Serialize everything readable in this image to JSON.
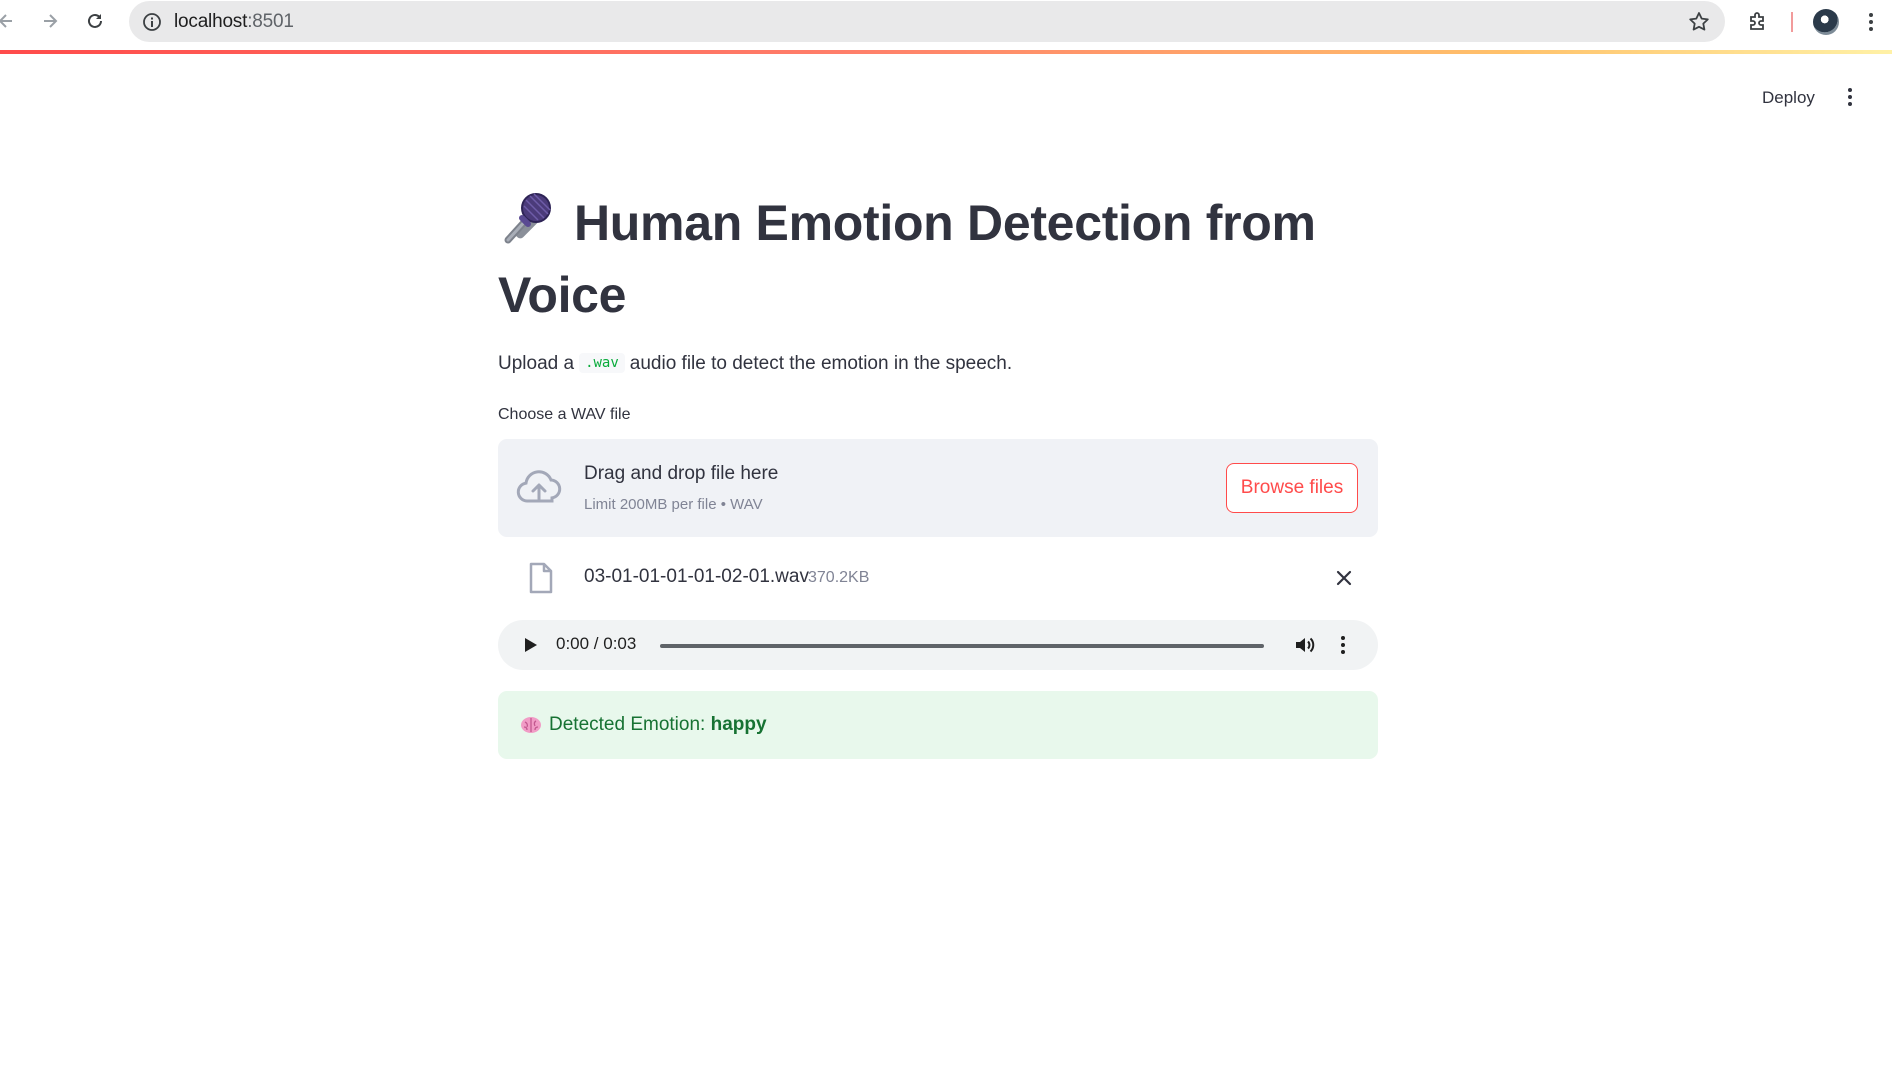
{
  "browser": {
    "url_host": "localhost",
    "url_port": ":8501"
  },
  "header": {
    "deploy_label": "Deploy"
  },
  "main": {
    "title": "Human Emotion Detection from Voice",
    "title_icon": "microphone-icon",
    "subtitle_before": "Upload a",
    "subtitle_code": ".wav",
    "subtitle_after": "audio file to detect the emotion in the speech."
  },
  "uploader": {
    "label": "Choose a WAV file",
    "drop_text": "Drag and drop file here",
    "limit_text": "Limit 200MB per file • WAV",
    "browse_label": "Browse files"
  },
  "file": {
    "name": "03-01-01-01-01-02-01.wav",
    "size": "370.2KB"
  },
  "audio": {
    "time": "0:00 / 0:03"
  },
  "result": {
    "icon": "brain-icon",
    "label": "Detected Emotion:",
    "emotion": "happy"
  },
  "colors": {
    "accent": "#ff4b4b",
    "success_bg": "#e8f8ec",
    "success_text": "#177233"
  }
}
